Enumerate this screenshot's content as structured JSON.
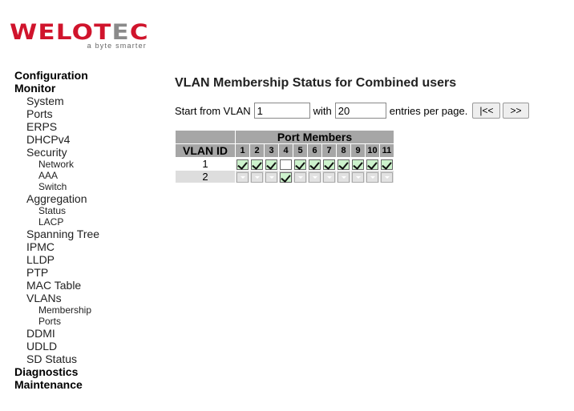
{
  "logo": {
    "brand_main": "WELOT",
    "brand_gray": "E",
    "brand_end": "C",
    "tagline": "a byte smarter",
    "brand_color": "#d0142c"
  },
  "nav": {
    "configuration": "Configuration",
    "monitor": "Monitor",
    "monitor_items": {
      "system": "System",
      "ports": "Ports",
      "erps": "ERPS",
      "dhcpv4": "DHCPv4",
      "security": "Security",
      "security_network": "Network",
      "security_aaa": "AAA",
      "security_switch": "Switch",
      "aggregation": "Aggregation",
      "aggregation_status": "Status",
      "aggregation_lacp": "LACP",
      "spanning_tree": "Spanning Tree",
      "ipmc": "IPMC",
      "lldp": "LLDP",
      "ptp": "PTP",
      "mac_table": "MAC Table",
      "vlans": "VLANs",
      "vlans_membership": "Membership",
      "vlans_ports": "Ports",
      "ddmi": "DDMI",
      "udld": "UDLD",
      "sd_status": "SD Status"
    },
    "diagnostics": "Diagnostics",
    "maintenance": "Maintenance"
  },
  "page": {
    "title": "VLAN Membership Status for Combined users",
    "start_label": "Start from VLAN",
    "start_value": "1",
    "with_label": "with",
    "entries_value": "20",
    "entries_label": "entries per page.",
    "first_button": "|<<",
    "next_button": ">>"
  },
  "table": {
    "vlan_id_header": "VLAN ID",
    "port_members_header": "Port Members",
    "ports": [
      "1",
      "2",
      "3",
      "4",
      "5",
      "6",
      "7",
      "8",
      "9",
      "10",
      "11"
    ],
    "rows": [
      {
        "vlan_id": "1",
        "members": [
          "member",
          "member",
          "member",
          "empty",
          "member",
          "member",
          "member",
          "member",
          "member",
          "member",
          "member"
        ]
      },
      {
        "vlan_id": "2",
        "members": [
          "off",
          "off",
          "off",
          "member",
          "off",
          "off",
          "off",
          "off",
          "off",
          "off",
          "off"
        ]
      }
    ]
  }
}
